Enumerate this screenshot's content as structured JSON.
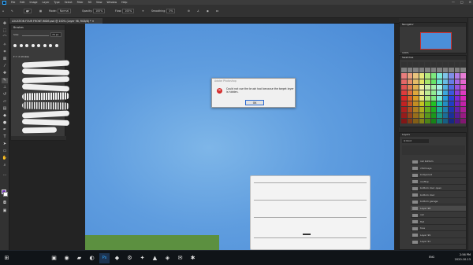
{
  "menubar": {
    "items": [
      "File",
      "Edit",
      "Image",
      "Layer",
      "Type",
      "Select",
      "Filter",
      "3D",
      "View",
      "Window",
      "Help"
    ],
    "window_controls": [
      "—",
      "□",
      "✕"
    ]
  },
  "options": {
    "mode_label": "Mode:",
    "mode_value": "Normal",
    "opacity_label": "Opacity:",
    "opacity_value": "100%",
    "flow_label": "Flow:",
    "flow_value": "100%",
    "smoothing_label": "Smoothing:",
    "smoothing_value": "0%"
  },
  "tab": {
    "title": "LOCATION FOUR FRONT WIDE.psd @ 100% (Layer 98, RGB/8) *"
  },
  "brushes": {
    "title": "Brushes",
    "size_label": "Size:",
    "size_value": "70 px",
    "folder_label": "2 strokes"
  },
  "dialog": {
    "title": "Adobe Photoshop",
    "message": "Could not use the brush tool because the target layer is hidden.",
    "ok_label": "OK"
  },
  "panels": {
    "navigator": "Navigator",
    "navigator_zoom": "100%",
    "swatches": "Swatches",
    "layers": "Layers",
    "layers_search": "Q Kind"
  },
  "layers": [
    {
      "name": "rail bottom"
    },
    {
      "name": "chimneys"
    },
    {
      "name": "bollywood"
    },
    {
      "name": "rooftop"
    },
    {
      "name": "bottom door open"
    },
    {
      "name": "bottom door"
    },
    {
      "name": "bottom garage"
    },
    {
      "name": "Layer 98"
    },
    {
      "name": "rail"
    },
    {
      "name": "flat"
    },
    {
      "name": "tree"
    },
    {
      "name": "Layer 99"
    },
    {
      "name": "Layer 91"
    }
  ],
  "taskbar": {
    "time": "2:56 PM",
    "date": "2020-10-13",
    "language": "ENG"
  },
  "colors": {
    "canvas_sky": "#5f9ddf",
    "grass": "#5c9040",
    "foreground": "#6a2fb0",
    "error_icon": "#d42b2b"
  }
}
